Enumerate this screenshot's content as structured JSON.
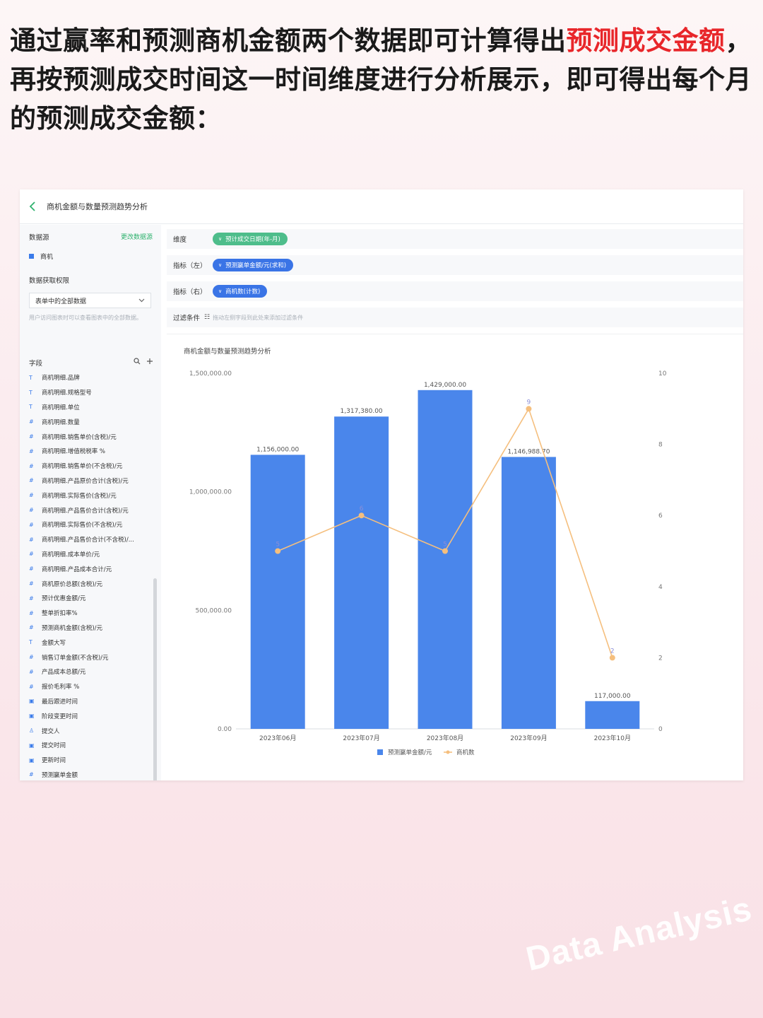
{
  "headline": {
    "part1": "通过赢率和预测商机金额两个数据即可计算得出",
    "highlight": "预测成交金额",
    "part2": "，再按预测成交时间这一时间维度进行分析展示，即可得出每个月的预测成交金额："
  },
  "topbar": {
    "title": "商机金额与数量预测趋势分析"
  },
  "sidebar": {
    "datasource_label": "数据源",
    "change_link": "更改数据源",
    "datasource_item": "商机",
    "permission_label": "数据获取权限",
    "permission_value": "表单中的全部数据",
    "permission_hint": "用户访问图表时可以查看图表中的全部数据。",
    "fields_label": "字段",
    "fields": [
      {
        "type": "T",
        "name": "商机明细.品牌"
      },
      {
        "type": "T",
        "name": "商机明细.规格型号"
      },
      {
        "type": "T",
        "name": "商机明细.单位"
      },
      {
        "type": "#",
        "name": "商机明细.数量"
      },
      {
        "type": "#",
        "name": "商机明细.销售单价(含税)/元"
      },
      {
        "type": "#",
        "name": "商机明细.增值税税率 %"
      },
      {
        "type": "#",
        "name": "商机明细.销售单价(不含税)/元"
      },
      {
        "type": "#",
        "name": "商机明细.产品原价合计(含税)/元"
      },
      {
        "type": "#",
        "name": "商机明细.实际售价(含税)/元"
      },
      {
        "type": "#",
        "name": "商机明细.产品售价合计(含税)/元"
      },
      {
        "type": "#",
        "name": "商机明细.实际售价(不含税)/元"
      },
      {
        "type": "#",
        "name": "商机明细.产品售价合计(不含税)/..."
      },
      {
        "type": "#",
        "name": "商机明细.成本单价/元"
      },
      {
        "type": "#",
        "name": "商机明细.产品成本合计/元"
      },
      {
        "type": "#",
        "name": "商机原价总额(含税)/元"
      },
      {
        "type": "#",
        "name": "预计优惠金额/元"
      },
      {
        "type": "#",
        "name": "整单折扣率%"
      },
      {
        "type": "#",
        "name": "预测商机金额(含税)/元"
      },
      {
        "type": "T",
        "name": "金额大写"
      },
      {
        "type": "#",
        "name": "销售订单金额(不含税)/元"
      },
      {
        "type": "#",
        "name": "产品成本总额/元"
      },
      {
        "type": "#",
        "name": "报价毛利率 %"
      },
      {
        "type": "▣",
        "name": "最后跟进时间"
      },
      {
        "type": "▣",
        "name": "阶段变更时间"
      },
      {
        "type": "♙",
        "name": "提交人"
      },
      {
        "type": "▣",
        "name": "提交时间"
      },
      {
        "type": "▣",
        "name": "更新时间"
      },
      {
        "type": "#",
        "name": "预测赢单金额"
      }
    ]
  },
  "config": {
    "dimension_label": "维度",
    "dimension_value": "预计成交日期(年-月)",
    "metric_left_label": "指标（左）",
    "metric_left_value": "预测赢单金额/元(求和)",
    "metric_right_label": "指标（右）",
    "metric_right_value": "商机数(计数)",
    "filter_label": "过滤条件",
    "filter_hint": "拖动左侧字段到此处来添加过滤条件"
  },
  "colors": {
    "bar": "#4a86eb",
    "line": "#f5bf7e",
    "accent": "#2fb26e",
    "highlight": "#e8262a"
  },
  "chart_data": {
    "type": "bar",
    "title": "商机金额与数量预测趋势分析",
    "categories": [
      "2023年06月",
      "2023年07月",
      "2023年08月",
      "2023年09月",
      "2023年10月"
    ],
    "series": [
      {
        "name": "预测赢单金额/元",
        "type": "bar",
        "axis": "left",
        "values": [
          1156000,
          1317380,
          1429000,
          1146988.7,
          117000
        ],
        "labels": [
          "1,156,000.00",
          "1,317,380.00",
          "1,429,000.00",
          "1,146,988.70",
          "117,000.00"
        ]
      },
      {
        "name": "商机数",
        "type": "line",
        "axis": "right",
        "values": [
          5,
          6,
          5,
          9,
          2
        ],
        "labels": [
          "5",
          "6",
          "5",
          "9",
          "2"
        ]
      }
    ],
    "y_left": {
      "ylim": [
        0,
        1500000
      ],
      "ticks": [
        "0.00",
        "500,000.00",
        "1,000,000.00",
        "1,500,000.00"
      ],
      "tick_values": [
        0,
        500000,
        1000000,
        1500000
      ]
    },
    "y_right": {
      "ylim": [
        0,
        10
      ],
      "ticks": [
        "0",
        "2",
        "4",
        "6",
        "8",
        "10"
      ],
      "tick_values": [
        0,
        2,
        4,
        6,
        8,
        10
      ]
    },
    "legend_position": "bottom-center"
  },
  "watermark": "Data Analysis"
}
